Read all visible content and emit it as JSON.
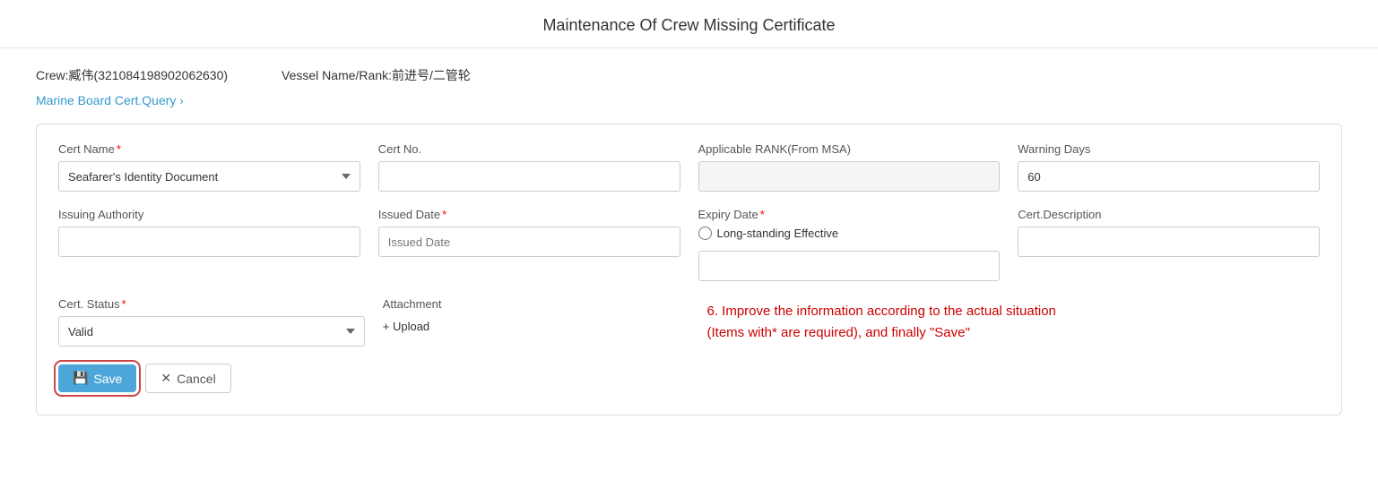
{
  "page": {
    "title": "Maintenance Of Crew Missing Certificate"
  },
  "meta": {
    "crew_label": "Crew:臧伟(321084198902062630)",
    "vessel_label": "Vessel Name/Rank:前进号/二管轮"
  },
  "breadcrumb": {
    "link_text": "Marine Board Cert.Query",
    "arrow": "›"
  },
  "form": {
    "cert_name_label": "Cert Name",
    "cert_name_required": "*",
    "cert_name_default": "Seafarer's Identity Document",
    "cert_name_options": [
      "Seafarer's Identity Document"
    ],
    "cert_no_label": "Cert No.",
    "cert_no_value": "",
    "applicable_rank_label": "Applicable RANK(From MSA)",
    "applicable_rank_value": "",
    "warning_days_label": "Warning Days",
    "warning_days_value": "60",
    "issuing_authority_label": "Issuing Authority",
    "issuing_authority_value": "",
    "issued_date_label": "Issued Date",
    "issued_date_required": "*",
    "issued_date_placeholder": "Issued Date",
    "expiry_date_label": "Expiry Date",
    "expiry_date_required": "*",
    "long_standing_label": "Long-standing Effective",
    "expiry_date_value": "",
    "cert_description_label": "Cert.Description",
    "cert_description_value": "",
    "cert_status_label": "Cert. Status",
    "cert_status_required": "*",
    "cert_status_options": [
      "Valid"
    ],
    "cert_status_default": "Valid",
    "attachment_label": "Attachment",
    "upload_label": "+ Upload",
    "instruction_line1": "6. Improve the information according to the actual situation",
    "instruction_line2": "(Items with* are required), and finally \"Save\"",
    "save_label": "Save",
    "cancel_label": "Cancel"
  }
}
